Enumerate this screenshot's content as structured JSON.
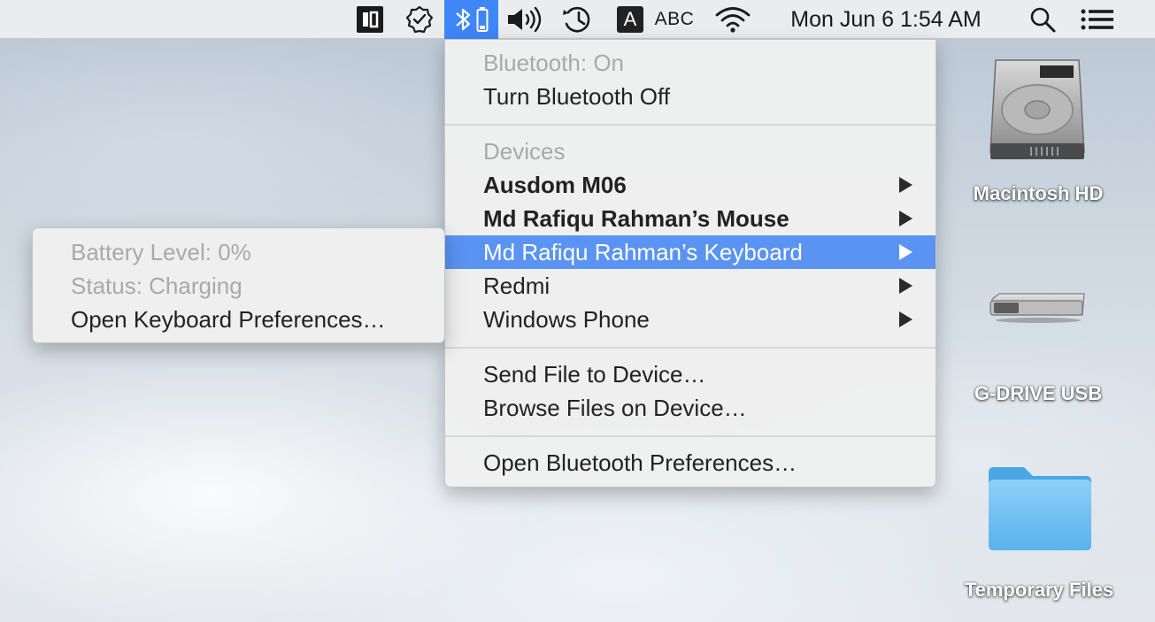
{
  "menubar": {
    "icons": [
      "sidebar-app-icon",
      "clean-status-icon",
      "bluetooth-icon",
      "volume-icon",
      "time-machine-icon",
      "input-source-icon",
      "wifi-icon",
      "spotlight-icon",
      "notification-center-icon"
    ],
    "input_letter": "A",
    "input_label": "ABC",
    "clock": "Mon Jun 6  1:54 AM"
  },
  "bluetooth_menu": {
    "status": "Bluetooth: On",
    "toggle": "Turn Bluetooth Off",
    "devices_header": "Devices",
    "devices": [
      {
        "label": "Ausdom M06",
        "connected": true
      },
      {
        "label": "Md Rafiqu Rahman’s Mouse",
        "connected": true
      },
      {
        "label": "Md Rafiqu Rahman’s Keyboard",
        "connected": false,
        "highlighted": true
      },
      {
        "label": "Redmi",
        "connected": false
      },
      {
        "label": "Windows Phone",
        "connected": false
      }
    ],
    "send_file": "Send File to Device…",
    "browse_files": "Browse Files on Device…",
    "preferences": "Open Bluetooth Preferences…"
  },
  "keyboard_submenu": {
    "battery": "Battery Level: 0%",
    "status": "Status: Charging",
    "preferences": "Open Keyboard Preferences…"
  },
  "desktop": {
    "items": [
      {
        "label": "Macintosh HD",
        "icon": "hard-drive-icon"
      },
      {
        "label": "G-DRIVE USB",
        "icon": "external-drive-icon"
      },
      {
        "label": "Temporary Files",
        "icon": "folder-icon"
      }
    ]
  },
  "colors": {
    "highlight": "#5a93f2",
    "menubar_active": "#3f86f7",
    "disabled_text": "#a9a9a9"
  }
}
